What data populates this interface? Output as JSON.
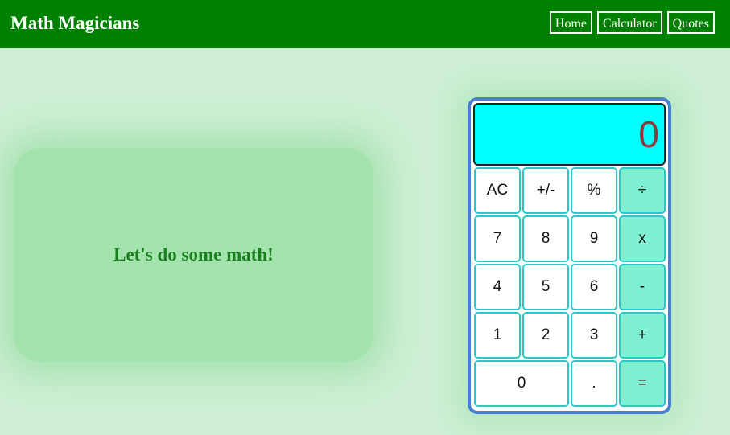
{
  "navbar": {
    "brand": "Math Magicians",
    "links": [
      "Home",
      "Calculator",
      "Quotes"
    ]
  },
  "hero": {
    "text": "Let's do some math!"
  },
  "calculator": {
    "display": "0",
    "keys": [
      {
        "label": "AC",
        "type": "func"
      },
      {
        "label": "+/-",
        "type": "func"
      },
      {
        "label": "%",
        "type": "func"
      },
      {
        "label": "÷",
        "type": "op"
      },
      {
        "label": "7",
        "type": "num"
      },
      {
        "label": "8",
        "type": "num"
      },
      {
        "label": "9",
        "type": "num"
      },
      {
        "label": "x",
        "type": "op"
      },
      {
        "label": "4",
        "type": "num"
      },
      {
        "label": "5",
        "type": "num"
      },
      {
        "label": "6",
        "type": "num"
      },
      {
        "label": "-",
        "type": "op"
      },
      {
        "label": "1",
        "type": "num"
      },
      {
        "label": "2",
        "type": "num"
      },
      {
        "label": "3",
        "type": "num"
      },
      {
        "label": "+",
        "type": "op"
      },
      {
        "label": "0",
        "type": "num"
      },
      {
        "label": ".",
        "type": "num"
      },
      {
        "label": "=",
        "type": "op"
      }
    ]
  },
  "colors": {
    "navbar": "#008000",
    "background": "#cdeed4",
    "hero_bg": "#a3e3ad",
    "hero_text": "#1a7f1f",
    "display_bg": "#00ffff",
    "display_text": "#8b3a3a",
    "operator_key": "#7ff0d2",
    "calc_border": "#4a7fcf"
  }
}
